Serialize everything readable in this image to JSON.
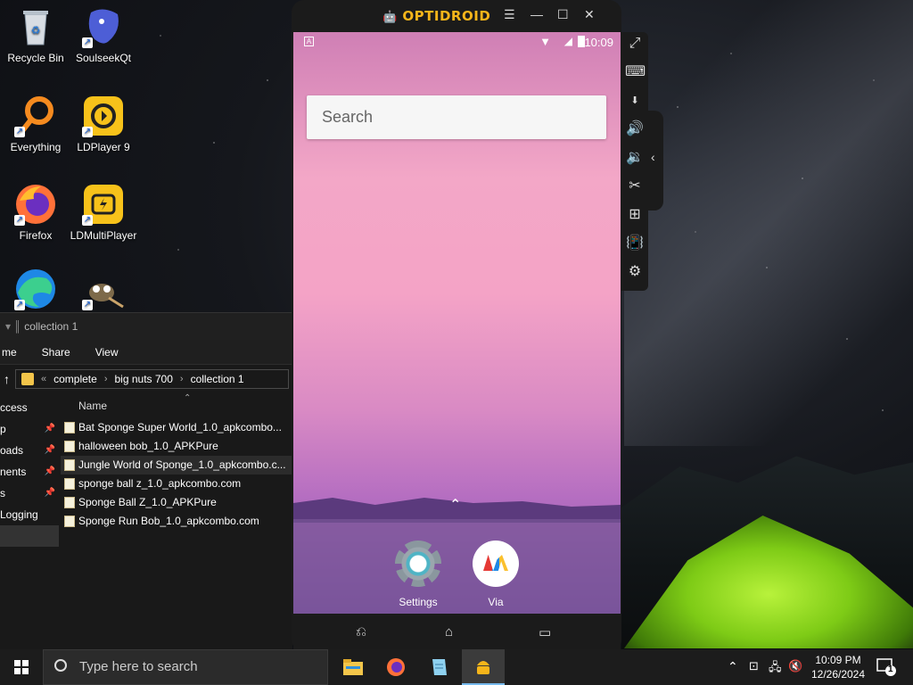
{
  "desktop": {
    "icons": [
      {
        "label": "Recycle Bin",
        "icon": "recycle-bin-icon"
      },
      {
        "label": "SoulseekQt",
        "icon": "soulseek-icon"
      },
      {
        "label": "Everything",
        "icon": "everything-search-icon"
      },
      {
        "label": "LDPlayer 9",
        "icon": "ldplayer-icon"
      },
      {
        "label": "Firefox",
        "icon": "firefox-icon"
      },
      {
        "label": "LDMultiPlayer",
        "icon": "ldmultiplayer-icon"
      },
      {
        "label": "",
        "icon": "edge-icon"
      },
      {
        "label": "",
        "icon": "gimp-icon"
      }
    ]
  },
  "explorer": {
    "title": "collection 1",
    "ribbon": [
      "me",
      "Share",
      "View"
    ],
    "breadcrumb": [
      "complete",
      "big nuts 700",
      "collection 1"
    ],
    "nav": [
      {
        "label": "ccess",
        "pinned": false
      },
      {
        "label": "p",
        "pinned": true
      },
      {
        "label": "oads",
        "pinned": true
      },
      {
        "label": "nents",
        "pinned": true
      },
      {
        "label": "s",
        "pinned": true
      },
      {
        "label": "Logging",
        "pinned": false
      }
    ],
    "column": "Name",
    "files": [
      "Bat Sponge Super World_1.0_apkcombo...",
      "halloween bob_1.0_APKPure",
      "Jungle World of Sponge_1.0_apkcombo.c...",
      "sponge ball z_1.0_apkcombo.com",
      "Sponge Ball Z_1.0_APKPure",
      "Sponge Run Bob_1.0_apkcombo.com"
    ]
  },
  "emulator": {
    "brand": "OPTIDROID",
    "status_time": "10:09",
    "search_placeholder": "Search",
    "apps": [
      {
        "label": "Settings",
        "icon": "settings-gear-icon"
      },
      {
        "label": "Via",
        "icon": "via-browser-icon"
      }
    ],
    "side_buttons": [
      "fullscreen-icon",
      "keyboard-icon",
      "install-apk-icon",
      "volume-up-icon",
      "volume-down-icon",
      "screenshot-scissors-icon",
      "multi-instance-icon",
      "shake-icon",
      "settings-icon"
    ]
  },
  "taskbar": {
    "search_placeholder": "Type here to search",
    "time": "10:09 PM",
    "date": "12/26/2024",
    "notification_count": "1"
  },
  "colors": {
    "accent": "#f6b51a",
    "taskbar": "#1c1c1c"
  }
}
